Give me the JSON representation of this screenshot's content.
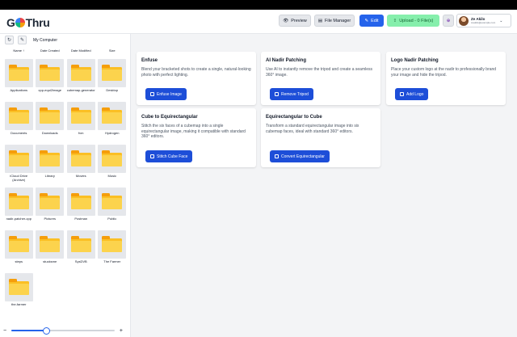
{
  "app": {
    "logo_left": "G",
    "logo_right": "Thru"
  },
  "header": {
    "preview": "Preview",
    "file_manager": "File Manager",
    "edit": "Edit",
    "upload": "Upload - 0 File(s)",
    "user_name": "Ze Akilo",
    "user_email": "zeakilo@example.com"
  },
  "explorer": {
    "path": "My Computer",
    "columns": [
      "Name",
      "Date Created",
      "Date Modified",
      "Size"
    ],
    "sort_arrow": "↑",
    "folders": [
      "Applications",
      "cpp-equi2image",
      "cubemap-generator",
      "Desktop",
      "Documents",
      "Downloads",
      "fvm",
      "Hydrogen",
      "iCloud Drive (Archive)",
      "Library",
      "Movies",
      "Music",
      "nadir-patcher-cpp",
      "Pictures",
      "Postman",
      "Public",
      "steps",
      "stucksme",
      "SysDVB",
      "The Farmer",
      "the-farmer"
    ],
    "zoom_fraction": 0.34,
    "zoom_minus": "−",
    "zoom_plus": "+"
  },
  "cards": [
    {
      "title": "Enfuse",
      "description": "Blend your bracketed shots to create a single, natural-looking photo with perfect lighting.",
      "button": "Enfuse Image"
    },
    {
      "title": "AI Nadir Patching",
      "description": "Use AI to instantly remove the tripod and create a seamless 360° image.",
      "button": "Remove Tripod"
    },
    {
      "title": "Logo Nadir Patching",
      "description": "Place your custom logo at the nadir to professionally brand your image and hide the tripod.",
      "button": "Add Logo"
    },
    {
      "title": "Cube to Equirectangular",
      "description": "Stitch the six faces of a cubemap into a single equirectangular image, making it compatible with standard 360° editors.",
      "button": "Stitch Cube Face"
    },
    {
      "title": "Equirectangular to Cube",
      "description": "Transform a standard equirectangular image into six cubemap faces, ideal with standard 360° editors.",
      "button": "Convert Equirectangular"
    }
  ],
  "colors": {
    "accent": "#2563eb",
    "upload": "#86efac"
  }
}
